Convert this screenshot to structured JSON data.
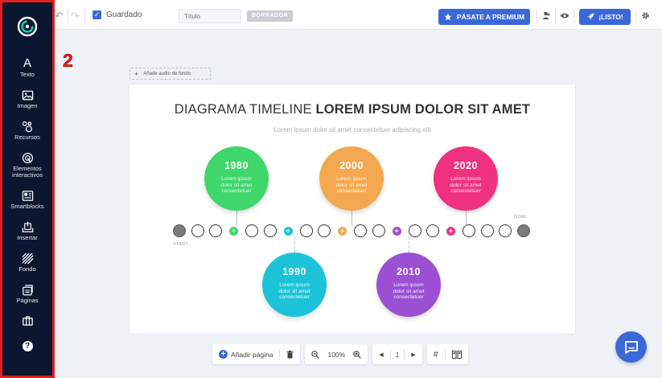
{
  "sidebar": {
    "items": [
      {
        "label": "Texto",
        "glyph": "A"
      },
      {
        "label": "Imagen"
      },
      {
        "label": "Recursos"
      },
      {
        "label": "Elementos interactivos"
      },
      {
        "label": "Smartblocks"
      },
      {
        "label": "Insertar"
      },
      {
        "label": "Fondo"
      },
      {
        "label": "Páginas"
      }
    ],
    "help_glyph": "?"
  },
  "annotation": {
    "number": "2",
    "color": "#e0201c"
  },
  "topbar": {
    "saved_label": "Guardado",
    "title_placeholder": "Título",
    "draft_label": "BORRADOR",
    "premium_label": "PÁSATE A PREMIUM",
    "publish_label": "¡LISTO!"
  },
  "canvas": {
    "audio_label": "Añade audio de fondo"
  },
  "slide": {
    "title_light": "DIAGRAMA TIMELINE ",
    "title_bold": "LOREM IPSUM DOLOR SIT AMET",
    "subtitle": "Lorem ipsum dolor sit amet consectetuer adipiscing elit",
    "start_label": "START",
    "goal_label": "GOAL",
    "milestones": [
      {
        "year": "1980",
        "text": "Lorem ipsum dolor sit amet consectetuer",
        "color": "#3fd66b"
      },
      {
        "year": "2000",
        "text": "Lorem ipsum dolor sit amet consectetuer",
        "color": "#f3a84f"
      },
      {
        "year": "2020",
        "text": "Lorem ipsum dolor sit amet consectetuer",
        "color": "#f0317f"
      },
      {
        "year": "1990",
        "text": "Lorem ipsum dolor sit amet consectetuer",
        "color": "#1cc3d8"
      },
      {
        "year": "2010",
        "text": "Lorem ipsum dolor sit amet consectetuer",
        "color": "#9b4fd3"
      }
    ]
  },
  "bottombar": {
    "add_page": "Añadir página",
    "zoom": "100%",
    "page": "1"
  },
  "colors": {
    "accent": "#3b68d8",
    "sidebar": "#0b1730"
  }
}
